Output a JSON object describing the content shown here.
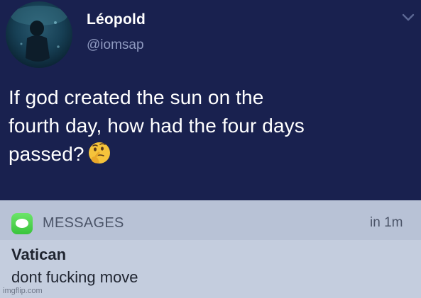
{
  "tweet": {
    "display_name": "Léopold",
    "handle": "@iomsap",
    "text_lines": [
      "If god created the sun on the",
      "fourth day, how had the four days",
      "passed?"
    ],
    "emoji": "thinking-face",
    "menu_icon": "chevron-down-icon"
  },
  "notification": {
    "app_icon": "messages-icon",
    "app_name": "MESSAGES",
    "time": "in 1m",
    "sender": "Vatican",
    "message": "dont fucking move"
  },
  "watermark": "imgflip.com"
}
